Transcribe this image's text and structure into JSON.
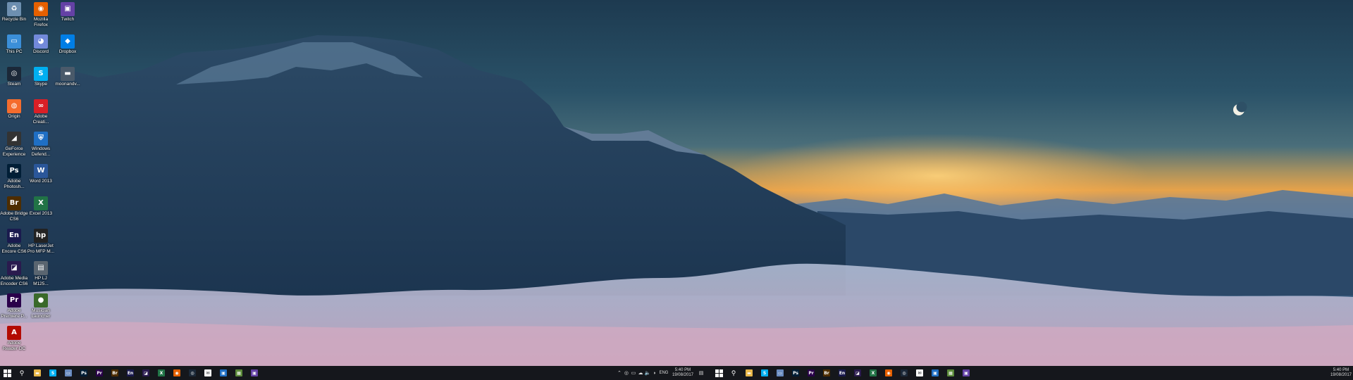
{
  "desktop": {
    "icons": [
      {
        "label": "Recycle Bin",
        "icon": "recycle-bin-icon",
        "color": "#6d8fb0",
        "glyph": "♻"
      },
      {
        "label": "Mozilla Firefox",
        "icon": "firefox-icon",
        "color": "#e66000",
        "glyph": "◉"
      },
      {
        "label": "Twitch",
        "icon": "twitch-icon",
        "color": "#6441a5",
        "glyph": "▣"
      },
      {
        "label": "This PC",
        "icon": "this-pc-icon",
        "color": "#3b8fd9",
        "glyph": "▭"
      },
      {
        "label": "Discord",
        "icon": "discord-icon",
        "color": "#7289da",
        "glyph": "◕"
      },
      {
        "label": "Dropbox",
        "icon": "dropbox-icon",
        "color": "#007ee5",
        "glyph": "◆"
      },
      {
        "label": "Steam",
        "icon": "steam-icon",
        "color": "#1b2838",
        "glyph": "◎"
      },
      {
        "label": "Skype",
        "icon": "skype-icon",
        "color": "#00aff0",
        "glyph": "S"
      },
      {
        "label": "moonandv...",
        "icon": "image-file-icon",
        "color": "#4a5a6a",
        "glyph": "▬"
      },
      {
        "label": "Origin",
        "icon": "origin-icon",
        "color": "#f56c2d",
        "glyph": "◍"
      },
      {
        "label": "Adobe Creati...",
        "icon": "adobe-creative-cloud-icon",
        "color": "#da1f26",
        "glyph": "∞"
      },
      {
        "label": "GeForce Experience",
        "icon": "geforce-icon",
        "color": "#333333",
        "glyph": "◢"
      },
      {
        "label": "Windows Defend...",
        "icon": "windows-defender-icon",
        "color": "#1f6fc4",
        "glyph": "⛨"
      },
      {
        "label": "Adobe Photosh...",
        "icon": "photoshop-icon",
        "color": "#001e36",
        "glyph": "Ps"
      },
      {
        "label": "Word 2013",
        "icon": "word-icon",
        "color": "#2b579a",
        "glyph": "W"
      },
      {
        "label": "Adobe Bridge CS6",
        "icon": "bridge-icon",
        "color": "#4e2d00",
        "glyph": "Br"
      },
      {
        "label": "Excel 2013",
        "icon": "excel-icon",
        "color": "#217346",
        "glyph": "X"
      },
      {
        "label": "Adobe Encore CS6",
        "icon": "encore-icon",
        "color": "#1a1a4e",
        "glyph": "En"
      },
      {
        "label": "HP LaserJet Pro MFP M...",
        "icon": "hp-icon",
        "color": "#222222",
        "glyph": "hp"
      },
      {
        "label": "Adobe Media Encoder CS6",
        "icon": "media-encoder-icon",
        "color": "#2a1a4e",
        "glyph": "◪"
      },
      {
        "label": "HP LJ M125...",
        "icon": "printer-icon",
        "color": "#5a6570",
        "glyph": "▤"
      },
      {
        "label": "Adobe Premiere P...",
        "icon": "premiere-icon",
        "color": "#2a004a",
        "glyph": "Pr"
      },
      {
        "label": "Musician Launcher",
        "icon": "musician-launcher-icon",
        "color": "#3a6a2a",
        "glyph": "●"
      },
      {
        "label": "Adobe Reader DC",
        "icon": "adobe-reader-icon",
        "color": "#b30b00",
        "glyph": "A"
      }
    ]
  },
  "taskbar": {
    "left_apps": [
      {
        "name": "file-explorer",
        "color": "#e8b84a",
        "glyph": "▬"
      },
      {
        "name": "skype",
        "color": "#00aff0",
        "glyph": "S"
      },
      {
        "name": "app-window",
        "color": "#6a8cc0",
        "glyph": "▭"
      },
      {
        "name": "photoshop",
        "color": "#001e36",
        "glyph": "Ps"
      },
      {
        "name": "premiere",
        "color": "#2a004a",
        "glyph": "Pr"
      },
      {
        "name": "bridge",
        "color": "#4e2d00",
        "glyph": "Br"
      },
      {
        "name": "encore",
        "color": "#1a1a4e",
        "glyph": "En"
      },
      {
        "name": "media-encoder",
        "color": "#2a1a4e",
        "glyph": "◪"
      },
      {
        "name": "excel",
        "color": "#217346",
        "glyph": "X"
      },
      {
        "name": "firefox",
        "color": "#e66000",
        "glyph": "◉"
      },
      {
        "name": "steam",
        "color": "#1b2838",
        "glyph": "◎"
      },
      {
        "name": "mail",
        "color": "#ffffff",
        "glyph": "✉"
      },
      {
        "name": "app-blue",
        "color": "#1f6fc4",
        "glyph": "▣"
      },
      {
        "name": "minecraft",
        "color": "#5b8a3a",
        "glyph": "▦"
      },
      {
        "name": "twitch",
        "color": "#6441a5",
        "glyph": "▣"
      }
    ],
    "tray": {
      "language": "ENG",
      "time": "5:40 PM",
      "date": "19/08/2017"
    },
    "right_apps": [
      {
        "name": "file-explorer",
        "color": "#e8b84a",
        "glyph": "▬"
      },
      {
        "name": "skype",
        "color": "#00aff0",
        "glyph": "S"
      },
      {
        "name": "app-window",
        "color": "#6a8cc0",
        "glyph": "▭"
      },
      {
        "name": "photoshop",
        "color": "#001e36",
        "glyph": "Ps"
      },
      {
        "name": "premiere",
        "color": "#2a004a",
        "glyph": "Pr"
      },
      {
        "name": "bridge",
        "color": "#4e2d00",
        "glyph": "Br"
      },
      {
        "name": "encore",
        "color": "#1a1a4e",
        "glyph": "En"
      },
      {
        "name": "media-encoder",
        "color": "#2a1a4e",
        "glyph": "◪"
      },
      {
        "name": "excel",
        "color": "#217346",
        "glyph": "X"
      },
      {
        "name": "firefox",
        "color": "#e66000",
        "glyph": "◉"
      },
      {
        "name": "steam",
        "color": "#1b2838",
        "glyph": "◎"
      },
      {
        "name": "mail",
        "color": "#ffffff",
        "glyph": "✉"
      },
      {
        "name": "app-blue",
        "color": "#1f6fc4",
        "glyph": "▣"
      },
      {
        "name": "minecraft",
        "color": "#5b8a3a",
        "glyph": "▦"
      },
      {
        "name": "twitch",
        "color": "#6441a5",
        "glyph": "▣"
      }
    ],
    "tray2": {
      "time": "5:40 PM",
      "date": "19/08/2017"
    }
  }
}
